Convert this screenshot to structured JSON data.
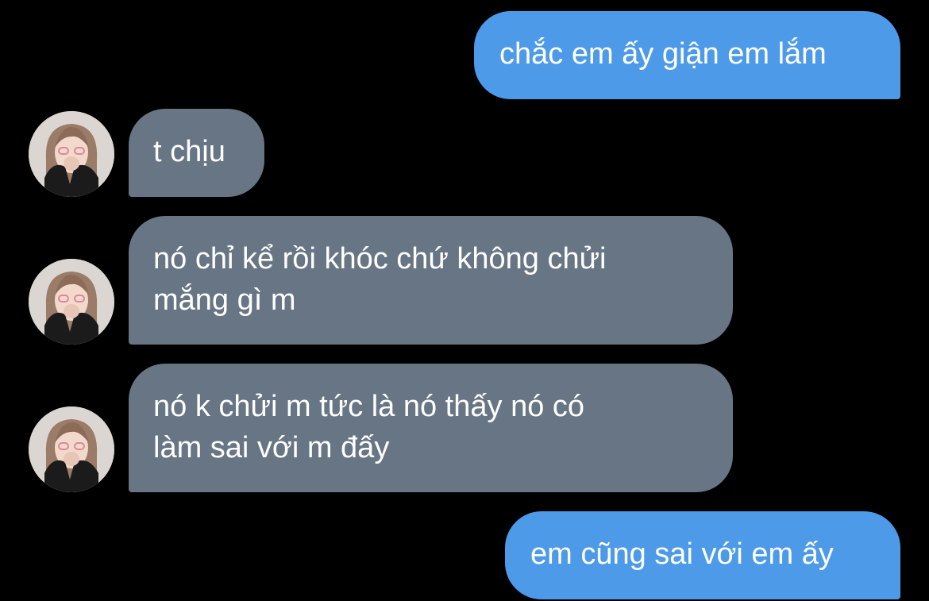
{
  "conversation": {
    "messages": [
      {
        "sender": "me",
        "text": "chắc em ấy giận em lắm"
      },
      {
        "sender": "them",
        "text": "t chịu"
      },
      {
        "sender": "them",
        "text": "nó chỉ kể rồi khóc chứ không chửi\nmắng gì m"
      },
      {
        "sender": "them",
        "text": "nó k chửi m tức là nó thấy nó có\nlàm sai với m đấy"
      },
      {
        "sender": "me",
        "text": "em cũng sai với em ấy"
      }
    ]
  },
  "colors": {
    "background": "#000000",
    "outgoing_bubble": "#4c9ae8",
    "incoming_bubble": "#677584",
    "text": "#ffffff"
  },
  "icons": {
    "contact_avatar": "contact-avatar"
  }
}
